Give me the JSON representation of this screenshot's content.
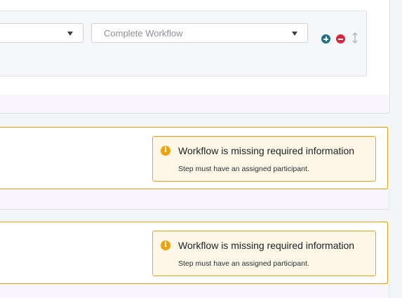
{
  "transition": {
    "first_select_value": "",
    "second_select_value": "Complete Workflow"
  },
  "controls": {
    "add_icon": "plus-circle-icon",
    "remove_icon": "minus-circle-icon",
    "drag_icon": "vertical-resize-icon"
  },
  "alerts": [
    {
      "icon": "info-icon",
      "glyph": "i",
      "title": "Workflow is missing required information",
      "message": "Step must have an assigned participant."
    },
    {
      "icon": "info-icon",
      "glyph": "i",
      "title": "Workflow is missing required information",
      "message": "Step must have an assigned participant."
    }
  ],
  "footer_ghost_text": "",
  "colors": {
    "warning": "#e8a316",
    "warning_bg": "#fef6e6",
    "add": "#1d6f89",
    "remove": "#d7263d"
  }
}
